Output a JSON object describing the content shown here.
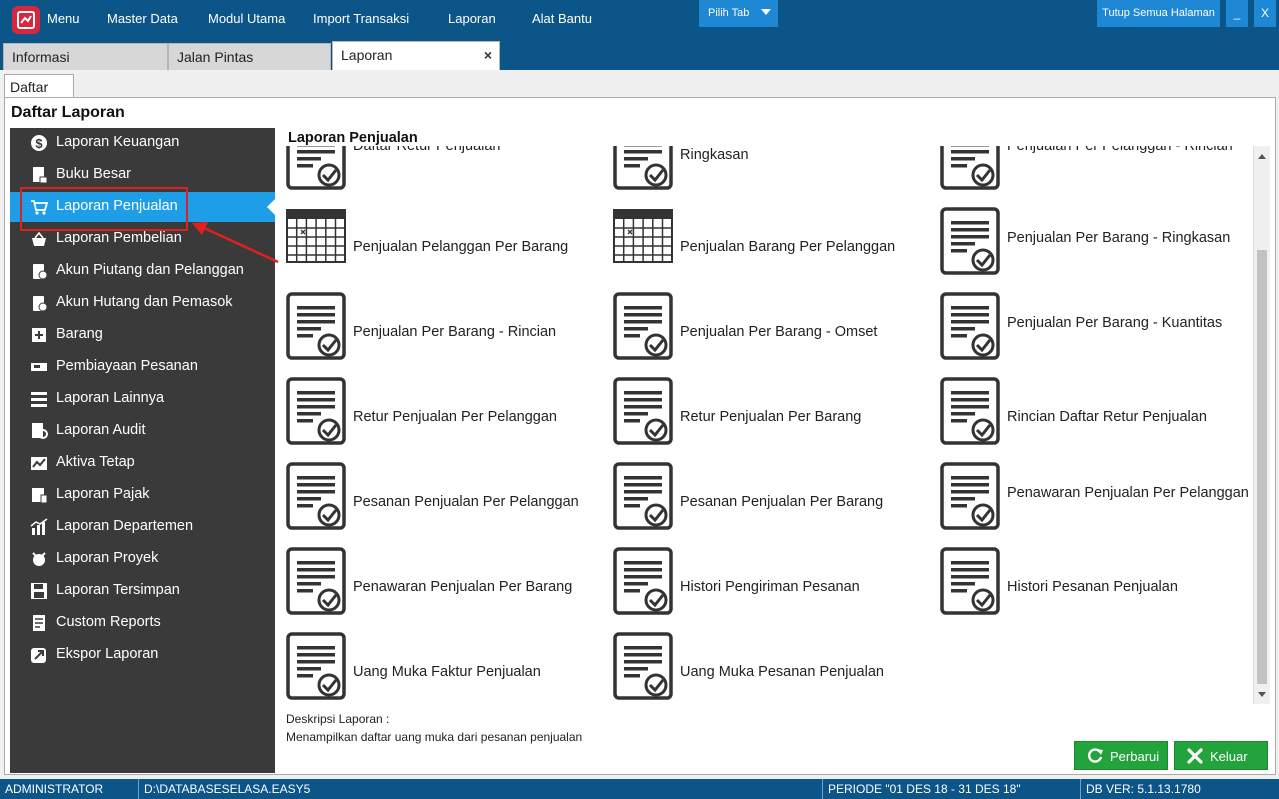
{
  "menubar": {
    "items": [
      "Menu",
      "Master Data",
      "Modul Utama",
      "Import Transaksi",
      "Laporan",
      "Alat Bantu"
    ],
    "pilih_tab": "Pilih Tab",
    "tutup_semua": "Tutup Semua Halaman",
    "minimize": "_",
    "close": "X"
  },
  "tabs": [
    {
      "label": "Informasi"
    },
    {
      "label": "Jalan Pintas"
    },
    {
      "label": "Laporan",
      "close": "×"
    }
  ],
  "subtab": "Daftar",
  "panel_title": "Daftar Laporan",
  "sidebar": {
    "items": [
      {
        "label": "Laporan Keuangan",
        "icon": "dollar-icon"
      },
      {
        "label": "Buku Besar",
        "icon": "ledger-icon"
      },
      {
        "label": "Laporan Penjualan",
        "icon": "cart-icon",
        "selected": true
      },
      {
        "label": "Laporan Pembelian",
        "icon": "basket-icon"
      },
      {
        "label": "Akun Piutang dan Pelanggan",
        "icon": "receivable-icon"
      },
      {
        "label": "Akun Hutang dan Pemasok",
        "icon": "payable-icon"
      },
      {
        "label": "Barang",
        "icon": "box-icon"
      },
      {
        "label": "Pembiayaan Pesanan",
        "icon": "order-financing-icon"
      },
      {
        "label": "Laporan Lainnya",
        "icon": "list-icon"
      },
      {
        "label": "Laporan Audit",
        "icon": "audit-icon"
      },
      {
        "label": "Aktiva Tetap",
        "icon": "asset-chart-icon"
      },
      {
        "label": "Laporan Pajak",
        "icon": "tax-icon"
      },
      {
        "label": "Laporan Departemen",
        "icon": "department-chart-icon"
      },
      {
        "label": "Laporan Proyek",
        "icon": "project-icon"
      },
      {
        "label": "Laporan Tersimpan",
        "icon": "save-icon"
      },
      {
        "label": "Custom Reports",
        "icon": "custom-report-icon"
      },
      {
        "label": "Ekspor Laporan",
        "icon": "export-icon"
      }
    ]
  },
  "report_section_title": "Laporan Penjualan",
  "reports": [
    {
      "label": "Daftar Retur Penjualan",
      "icon": "report-doc-icon"
    },
    {
      "label": "Ringkasan",
      "icon": "report-doc-icon"
    },
    {
      "label": "Penjualan Per Pelanggan - Rincian",
      "icon": "report-doc-icon"
    },
    {
      "label": "Penjualan Pelanggan Per Barang",
      "icon": "grid-report-icon"
    },
    {
      "label": "Penjualan Barang Per Pelanggan",
      "icon": "grid-report-icon"
    },
    {
      "label": "Penjualan Per Barang - Ringkasan",
      "icon": "report-doc-icon"
    },
    {
      "label": "Penjualan Per Barang - Rincian",
      "icon": "report-doc-icon"
    },
    {
      "label": "Penjualan Per Barang - Omset",
      "icon": "report-doc-icon"
    },
    {
      "label": "Penjualan Per Barang - Kuantitas",
      "icon": "report-doc-icon"
    },
    {
      "label": "Retur Penjualan Per Pelanggan",
      "icon": "report-doc-icon"
    },
    {
      "label": "Retur Penjualan Per Barang",
      "icon": "report-doc-icon"
    },
    {
      "label": "Rincian Daftar Retur Penjualan",
      "icon": "report-doc-icon"
    },
    {
      "label": "Pesanan Penjualan Per Pelanggan",
      "icon": "report-doc-icon"
    },
    {
      "label": "Pesanan Penjualan Per Barang",
      "icon": "report-doc-icon"
    },
    {
      "label": "Penawaran Penjualan Per Pelanggan",
      "icon": "report-doc-icon"
    },
    {
      "label": "Penawaran Penjualan Per Barang",
      "icon": "report-doc-icon"
    },
    {
      "label": "Histori Pengiriman Pesanan",
      "icon": "report-doc-icon"
    },
    {
      "label": "Histori Pesanan Penjualan",
      "icon": "report-doc-icon"
    },
    {
      "label": "Uang Muka Faktur Penjualan",
      "icon": "report-doc-icon"
    },
    {
      "label": "Uang Muka Pesanan Penjualan",
      "icon": "report-doc-icon"
    }
  ],
  "description": {
    "label": "Deskripsi Laporan :",
    "text": "Menampilkan daftar uang muka dari pesanan penjualan"
  },
  "buttons": {
    "refresh": "Perbarui",
    "exit": "Keluar"
  },
  "statusbar": {
    "user": "ADMINISTRATOR",
    "database": "D:\\DATABASESELASA.EASY5",
    "periode": "PERIODE \"01 DES 18 - 31 DES 18\"",
    "db_ver": "DB VER: 5.1.13.1780"
  },
  "colors": {
    "brand_blue": "#0c5588",
    "accent_blue": "#1e9ee6",
    "sidebar_bg": "#3a3a3a",
    "button_green": "#22a33b",
    "logo_red": "#d7263d",
    "annotation_red": "#e02020"
  }
}
